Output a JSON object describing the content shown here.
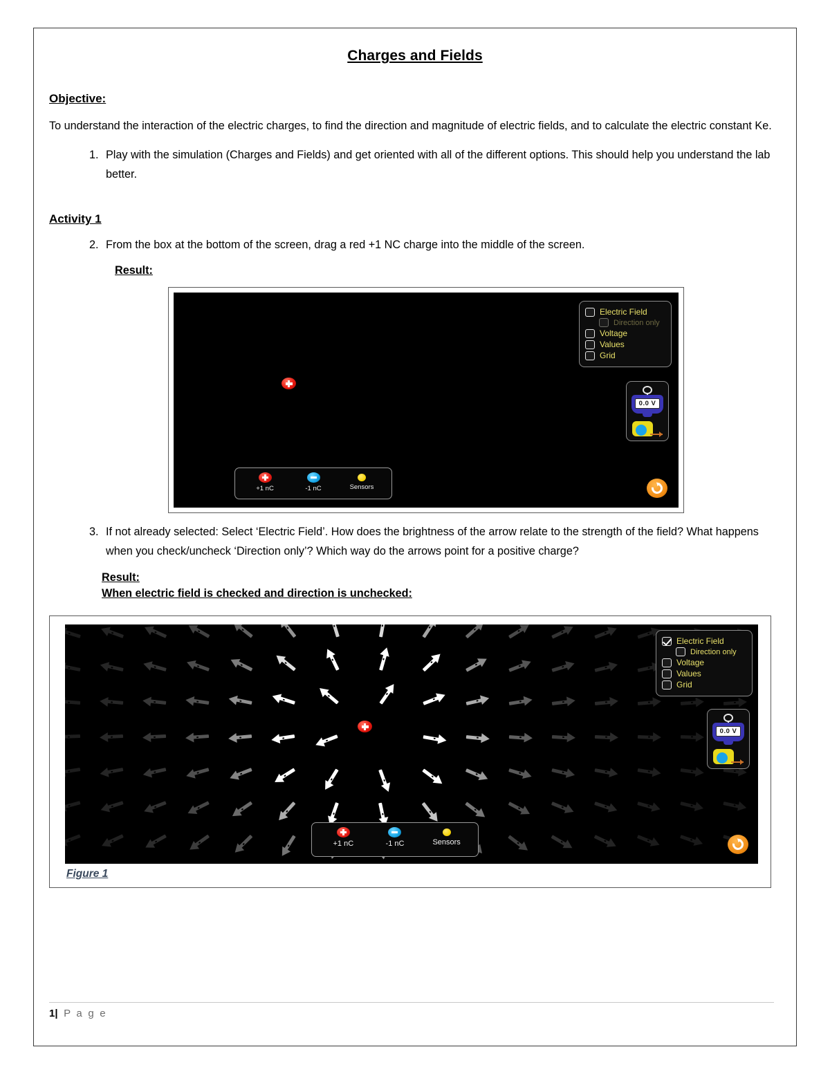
{
  "document": {
    "title": "Charges and Fields",
    "objective_heading": "Objective:",
    "objective_text": "To understand the interaction of the electric charges, to find the direction and magnitude of electric fields, and to calculate the electric constant Ke.",
    "item1": "Play with the simulation (Charges and Fields) and get oriented with all of the different options. This should help you understand the lab better.",
    "activity_heading": "Activity 1",
    "item2": "From the box at the bottom of the screen, drag a red +1 NC charge into the middle of the screen.",
    "result_label": "Result:",
    "item3": "If not already selected: Select ‘Electric Field’. How does the brightness of the arrow relate to the strength of the field? What happens when you check/uncheck ‘Direction only’? Which way do the arrows point for a positive charge?",
    "result_label_2": "Result:",
    "subnote": "When electric field is checked and direction is unchecked:",
    "figure_caption": "Figure 1"
  },
  "footer": {
    "page_number": "1",
    "separator": "|",
    "page_word": "P a g e"
  },
  "simulation_1": {
    "controls": [
      {
        "label": "Electric Field",
        "checked": false,
        "enabled": true
      },
      {
        "label": "Direction only",
        "checked": false,
        "enabled": false
      },
      {
        "label": "Voltage",
        "checked": false,
        "enabled": true
      },
      {
        "label": "Values",
        "checked": false,
        "enabled": true
      },
      {
        "label": "Grid",
        "checked": false,
        "enabled": true
      }
    ],
    "voltmeter_reading": "0.0 V",
    "bucket": [
      {
        "label": "+1 nC",
        "type": "positive-charge"
      },
      {
        "label": "-1 nC",
        "type": "negative-charge"
      },
      {
        "label": "Sensors",
        "type": "sensor"
      }
    ],
    "reset_icon": "reset-icon",
    "placed_charge": "positive-charge",
    "field_visible": false
  },
  "simulation_2": {
    "controls": [
      {
        "label": "Electric Field",
        "checked": true,
        "enabled": true
      },
      {
        "label": "Direction only",
        "checked": false,
        "enabled": true
      },
      {
        "label": "Voltage",
        "checked": false,
        "enabled": true
      },
      {
        "label": "Values",
        "checked": false,
        "enabled": true
      },
      {
        "label": "Grid",
        "checked": false,
        "enabled": true
      }
    ],
    "voltmeter_reading": "0.0 V",
    "bucket": [
      {
        "label": "+1 nC",
        "type": "positive-charge"
      },
      {
        "label": "-1 nC",
        "type": "negative-charge"
      },
      {
        "label": "Sensors",
        "type": "sensor"
      }
    ],
    "reset_icon": "reset-icon",
    "placed_charge": "positive-charge",
    "field_visible": true
  },
  "colors": {
    "positive_charge": "#e8180f",
    "negative_charge": "#16a5e6",
    "sensor": "#f4d000",
    "control_label": "#e8e06a",
    "reset_button": "#f08c14",
    "voltmeter_body": "#3a35b5",
    "caption": "#39485c"
  }
}
